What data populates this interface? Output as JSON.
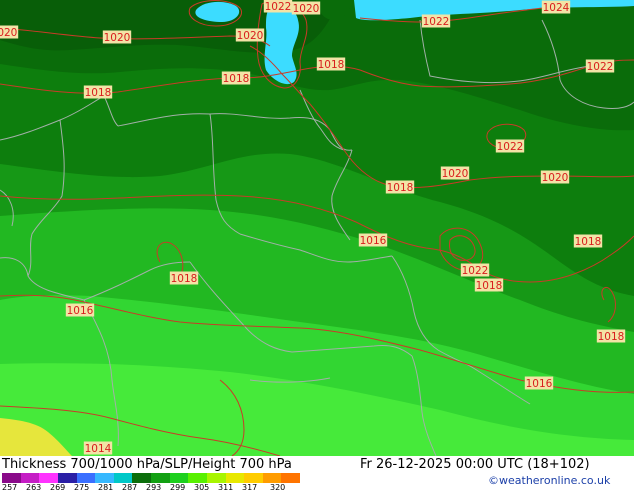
{
  "map": {
    "isobar_labels": [
      {
        "text": "1020",
        "id": "iso-20a"
      },
      {
        "text": "1022",
        "id": "iso-22a"
      },
      {
        "text": "1020",
        "id": "iso-20b"
      },
      {
        "text": "1022",
        "id": "iso-22b"
      },
      {
        "text": "1024",
        "id": "iso-24a"
      },
      {
        "text": "1020",
        "id": "iso-20c"
      },
      {
        "text": "1020",
        "id": "iso-20d"
      },
      {
        "text": "1022",
        "id": "iso-22c"
      },
      {
        "text": "1018",
        "id": "iso-18a"
      },
      {
        "text": "1018",
        "id": "iso-18b"
      },
      {
        "text": "1018",
        "id": "iso-18c"
      },
      {
        "text": "1022",
        "id": "iso-22d"
      },
      {
        "text": "1020",
        "id": "iso-20e"
      },
      {
        "text": "1020",
        "id": "iso-20f"
      },
      {
        "text": "1018",
        "id": "iso-18d"
      },
      {
        "text": "1016",
        "id": "iso-16a"
      },
      {
        "text": "1018",
        "id": "iso-18e"
      },
      {
        "text": "1022",
        "id": "iso-22e"
      },
      {
        "text": "1018",
        "id": "iso-18f"
      },
      {
        "text": "1018",
        "id": "iso-18g"
      },
      {
        "text": "1016",
        "id": "iso-16b"
      },
      {
        "text": "1018",
        "id": "iso-18h"
      },
      {
        "text": "1016",
        "id": "iso-16c"
      },
      {
        "text": "1014",
        "id": "iso-14a"
      }
    ]
  },
  "footer": {
    "title": "Thickness 700/1000 hPa/SLP/Height 700 hPa",
    "valid": "Fr 26-12-2025 00:00 UTC (18+102)",
    "credit": "©weatheronline.co.uk",
    "scale_ticks": [
      "257",
      "263",
      "269",
      "275",
      "281",
      "287",
      "293",
      "299",
      "305",
      "311",
      "317",
      "320"
    ],
    "scale_colors": [
      "#8a0a8a",
      "#c51dc5",
      "#ff33ff",
      "#2b1fa6",
      "#3a6fff",
      "#36b8ff",
      "#00c8c8",
      "#0b6e0b",
      "#12a012",
      "#1ed01e",
      "#58f000",
      "#a8f500",
      "#e8e800",
      "#ffcc00",
      "#ff9c00",
      "#ff7400"
    ]
  },
  "colors": {
    "dark_green": "#0a6f0a",
    "mid_green": "#128c12",
    "green": "#1ca61c",
    "light_green": "#2cc62c",
    "bright_green": "#3ae23a",
    "lime": "#56f03a",
    "yellow": "#e8e83a",
    "sea_cyan": "#3cdcff",
    "isobar": "#c83c28",
    "border": "#9aa6a0"
  }
}
